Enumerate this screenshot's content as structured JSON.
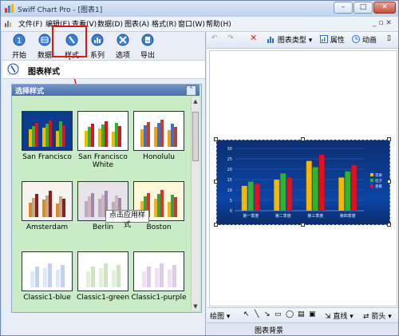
{
  "window": {
    "title": "Swiff Chart Pro - [图表1]"
  },
  "menu": [
    "文件(F)",
    "编辑(E)",
    "查看(V)",
    "数据(D)",
    "图表(A)",
    "格式(R)",
    "窗口(W)",
    "帮助(H)"
  ],
  "toolbar": {
    "start": "开始",
    "data": "数据",
    "style": "样式",
    "series": "系列",
    "options": "选项",
    "export": "导出"
  },
  "panel": {
    "title": "图表样式"
  },
  "gallery": {
    "header": "选择样式",
    "styles": [
      {
        "name": "San Francisco"
      },
      {
        "name": "San Francisco White"
      },
      {
        "name": "Honolulu"
      },
      {
        "name": "Amsterdam"
      },
      {
        "name": "Berlin"
      },
      {
        "name": "Boston"
      },
      {
        "name": "Classic1-blue"
      },
      {
        "name": "Classic1-green"
      },
      {
        "name": "Classic1-purple"
      }
    ],
    "tooltip": "点击应用样式"
  },
  "right_toolbar": {
    "chart_type": "图表类型",
    "properties": "属性",
    "animation": "动画"
  },
  "draw_toolbar": {
    "draw": "绘图",
    "line": "直线",
    "arrow": "箭头"
  },
  "status": {
    "text": "图表背景"
  },
  "chart_data": {
    "type": "bar",
    "categories": [
      "第一季度",
      "第二季度",
      "第三季度",
      "第四季度"
    ],
    "series": [
      {
        "name": "苹果",
        "values": [
          12,
          15,
          24,
          16
        ]
      },
      {
        "name": "桔子",
        "values": [
          14,
          18,
          21,
          19
        ]
      },
      {
        "name": "香蕉",
        "values": [
          13,
          16,
          27,
          22
        ]
      }
    ],
    "ylim": [
      0,
      30
    ],
    "yticks": [
      0,
      5,
      10,
      15,
      20,
      25,
      30
    ],
    "colors": [
      "#f5b700",
      "#2db52d",
      "#e01020"
    ],
    "legend": "right"
  }
}
